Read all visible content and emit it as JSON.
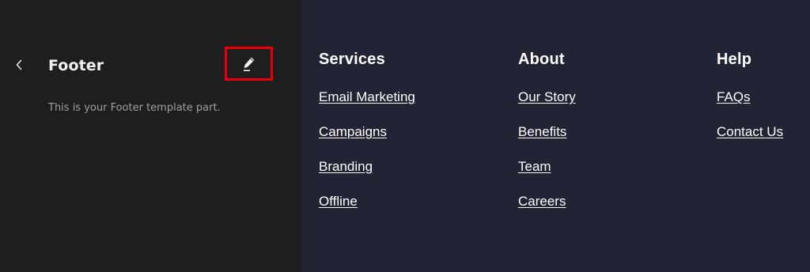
{
  "sidebar": {
    "back_icon": "chevron-left-icon",
    "title": "Footer",
    "edit_icon": "pencil-icon",
    "description": "This is your Footer template part.",
    "highlight_color": "#e8000b"
  },
  "preview": {
    "background": "#222335",
    "columns": [
      {
        "heading": "Services",
        "links": [
          "Email Marketing",
          "Campaigns",
          "Branding",
          "Offline"
        ]
      },
      {
        "heading": "About",
        "links": [
          "Our Story",
          "Benefits",
          "Team",
          "Careers"
        ]
      },
      {
        "heading": "Help",
        "links": [
          "FAQs",
          "Contact Us"
        ]
      }
    ]
  }
}
